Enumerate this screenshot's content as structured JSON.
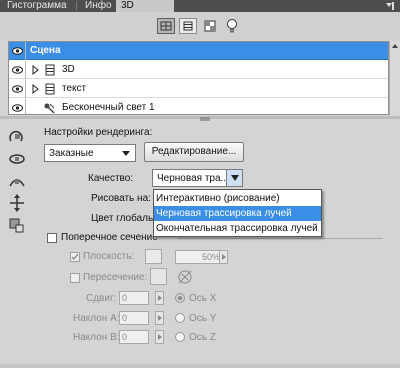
{
  "tabs": [
    {
      "label": "Гистограмма",
      "active": false
    },
    {
      "label": "Инфо",
      "active": false
    },
    {
      "label": "3D (Сцена)",
      "active": true
    }
  ],
  "toolbar": {
    "icons": [
      "scene-filter-icon",
      "mesh-filter-icon",
      "material-filter-icon",
      "light-filter-icon"
    ]
  },
  "tree": {
    "rows": [
      {
        "label": "Сцена",
        "selected": true
      },
      {
        "label": "3D",
        "selected": false
      },
      {
        "label": "текст",
        "selected": false
      },
      {
        "label": "Бесконечный свет 1",
        "selected": false
      }
    ]
  },
  "settings": {
    "render_label": "Настройки рендеринга:",
    "preset_value": "Заказные",
    "edit_button": "Редактирование...",
    "quality_label": "Качество:",
    "quality_value": "Черновая тра...",
    "paint_on_label": "Рисовать на:",
    "global_color_label": "Цвет глобаль",
    "cross_section_label": "Поперечное сечение",
    "planes_label": "Плоскость:",
    "planes_opacity": "50%",
    "intersection_label": "Пересечение:",
    "offset_label": "Сдвиг:",
    "offset_value": "0",
    "tilt_a_label": "Наклон А:",
    "tilt_a_value": "0",
    "tilt_b_label": "Наклон В:",
    "tilt_b_value": "0",
    "axis_x": "Ось X",
    "axis_y": "Ось Y",
    "axis_z": "Ось Z"
  },
  "quality_dropdown": {
    "options": [
      "Интерактивно (рисование)",
      "Черновая трассировка лучей",
      "Окончательная трассировка лучей"
    ],
    "highlighted_index": 1
  },
  "colors": {
    "selection": "#3a8ee6",
    "tabbar": "#4e4e4e",
    "panel": "#d4d4d4"
  }
}
